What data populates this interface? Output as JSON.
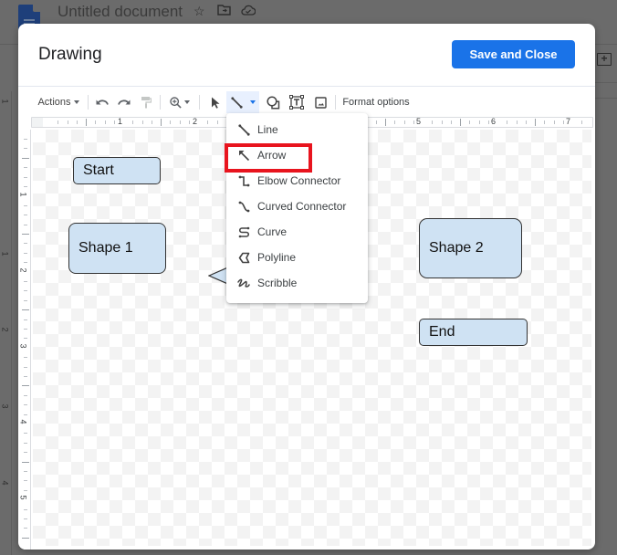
{
  "background_app": {
    "document_title": "Untitled document",
    "icons": [
      "star-icon",
      "move-to-folder-icon",
      "cloud-saved-icon",
      "add-comment-icon"
    ],
    "left_ruler_numbers": [
      "1",
      "1",
      "2",
      "3",
      "4"
    ]
  },
  "dialog": {
    "title": "Drawing",
    "save_button": "Save and Close"
  },
  "toolbar": {
    "actions_label": "Actions",
    "format_options_label": "Format options",
    "buttons": [
      {
        "name": "actions-menu",
        "label": "Actions"
      },
      {
        "name": "undo",
        "icon": "undo-icon"
      },
      {
        "name": "redo",
        "icon": "redo-icon"
      },
      {
        "name": "paint-format",
        "icon": "paint-format-icon"
      },
      {
        "name": "zoom",
        "icon": "zoom-in-icon"
      },
      {
        "name": "select",
        "icon": "cursor-icon"
      },
      {
        "name": "line",
        "icon": "line-icon",
        "active": true
      },
      {
        "name": "shape",
        "icon": "shape-icon"
      },
      {
        "name": "text-box",
        "icon": "text-box-icon"
      },
      {
        "name": "image",
        "icon": "image-icon"
      },
      {
        "name": "format-options",
        "label": "Format options"
      }
    ]
  },
  "rulers": {
    "horizontal_numbers": [
      "1",
      "2",
      "5",
      "6",
      "7"
    ],
    "vertical_numbers": [
      "1",
      "2",
      "3",
      "4",
      "5"
    ]
  },
  "canvas": {
    "shapes": [
      {
        "id": "start",
        "label": "Start"
      },
      {
        "id": "shape1",
        "label": "Shape 1"
      },
      {
        "id": "shape2",
        "label": "Shape 2"
      },
      {
        "id": "end",
        "label": "End"
      }
    ],
    "fill_color": "#cfe2f3"
  },
  "line_menu": {
    "items": [
      {
        "label": "Line",
        "icon": "line-icon"
      },
      {
        "label": "Arrow",
        "icon": "arrow-icon",
        "highlighted": true
      },
      {
        "label": "Elbow Connector",
        "icon": "elbow-connector-icon"
      },
      {
        "label": "Curved Connector",
        "icon": "curved-connector-icon"
      },
      {
        "label": "Curve",
        "icon": "curve-icon"
      },
      {
        "label": "Polyline",
        "icon": "polyline-icon"
      },
      {
        "label": "Scribble",
        "icon": "scribble-icon"
      }
    ],
    "highlight_color": "#e8141e"
  },
  "colors": {
    "accent": "#1a73e8",
    "active_tool_bg": "#e8f0fe"
  }
}
